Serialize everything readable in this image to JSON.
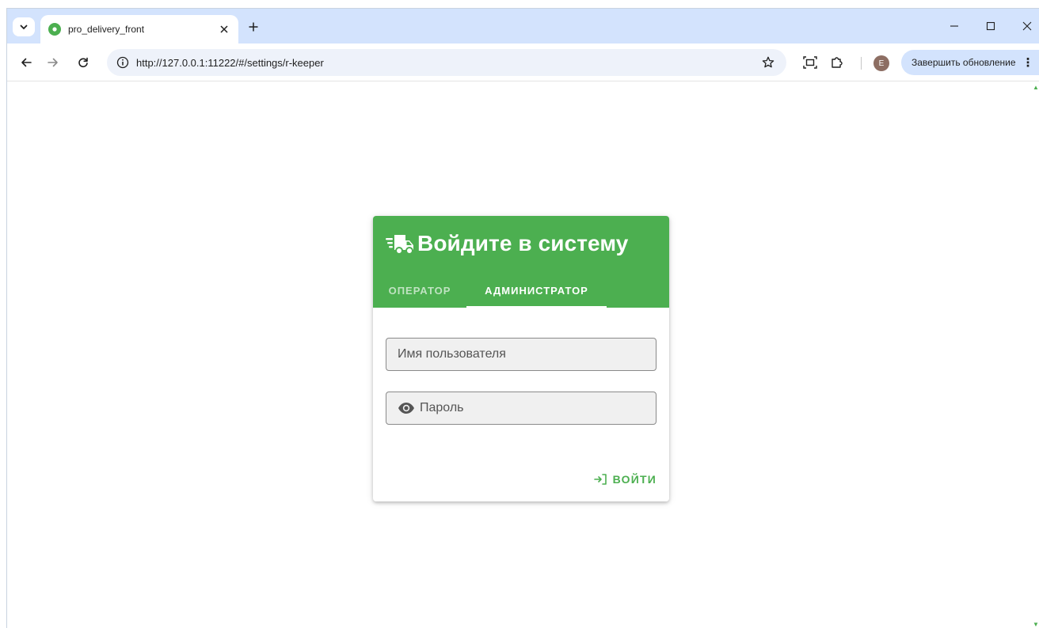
{
  "browser": {
    "tab_title": "pro_delivery_front",
    "url": "http://127.0.0.1:11222/#/settings/r-keeper",
    "profile_initial": "E",
    "update_button_label": "Завершить обновление"
  },
  "login": {
    "title": "Войдите в систему",
    "tabs": [
      {
        "label": "ОПЕРАТОР"
      },
      {
        "label": "АДМИНИСТРАТОР"
      }
    ],
    "username_placeholder": "Имя пользователя",
    "password_placeholder": "Пароль",
    "submit_label": "ВОЙТИ"
  },
  "theme": {
    "primary": "#4caf50",
    "tabstrip": "#d3e3fd",
    "avatar_color": "#8d6e63"
  },
  "icons": {
    "tab_search": "chevron-down-icon",
    "favicon": "app-favicon-icon",
    "close": "close-icon",
    "new_tab": "plus-icon",
    "back": "back-arrow-icon",
    "forward": "forward-arrow-icon",
    "reload": "reload-icon",
    "site_info": "info-icon",
    "bookmark": "star-icon",
    "screenshot": "screenshot-icon",
    "extensions": "puzzle-icon",
    "menu": "kebab-menu-icon",
    "truck": "truck-icon",
    "password_visibility": "eye-icon",
    "login": "login-icon"
  }
}
